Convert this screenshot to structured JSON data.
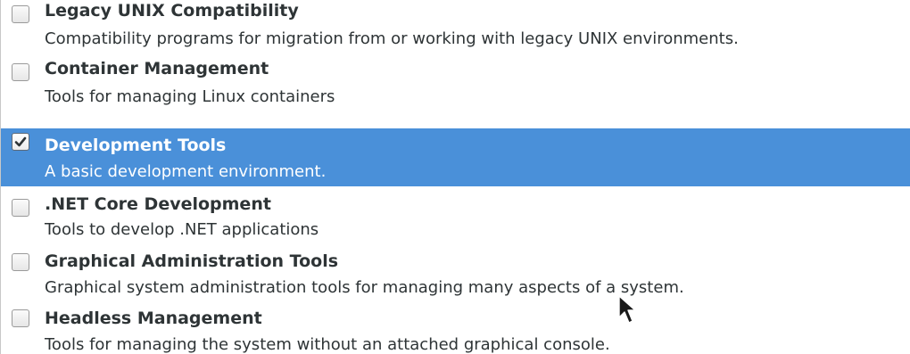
{
  "environments": [
    {
      "title": "Legacy UNIX Compatibility",
      "description": "Compatibility programs for migration from or working with legacy UNIX environments.",
      "checked": false,
      "selected": false
    },
    {
      "title": "Container Management",
      "description": "Tools for managing Linux containers",
      "checked": false,
      "selected": false
    },
    {
      "title": "Development Tools",
      "description": "A basic development environment.",
      "checked": true,
      "selected": true
    },
    {
      "title": ".NET Core Development",
      "description": "Tools to develop .NET applications",
      "checked": false,
      "selected": false
    },
    {
      "title": "Graphical Administration Tools",
      "description": "Graphical system administration tools for managing many aspects of a system.",
      "checked": false,
      "selected": false
    },
    {
      "title": "Headless Management",
      "description": "Tools for managing the system without an attached graphical console.",
      "checked": false,
      "selected": false
    }
  ],
  "colors": {
    "selection": "#4a90d9",
    "text": "#2e3436",
    "selected_text": "#ffffff"
  },
  "icons": {
    "checkbox": "checkbox-icon",
    "checkmark": "checkmark-icon",
    "cursor": "mouse-pointer-icon"
  }
}
